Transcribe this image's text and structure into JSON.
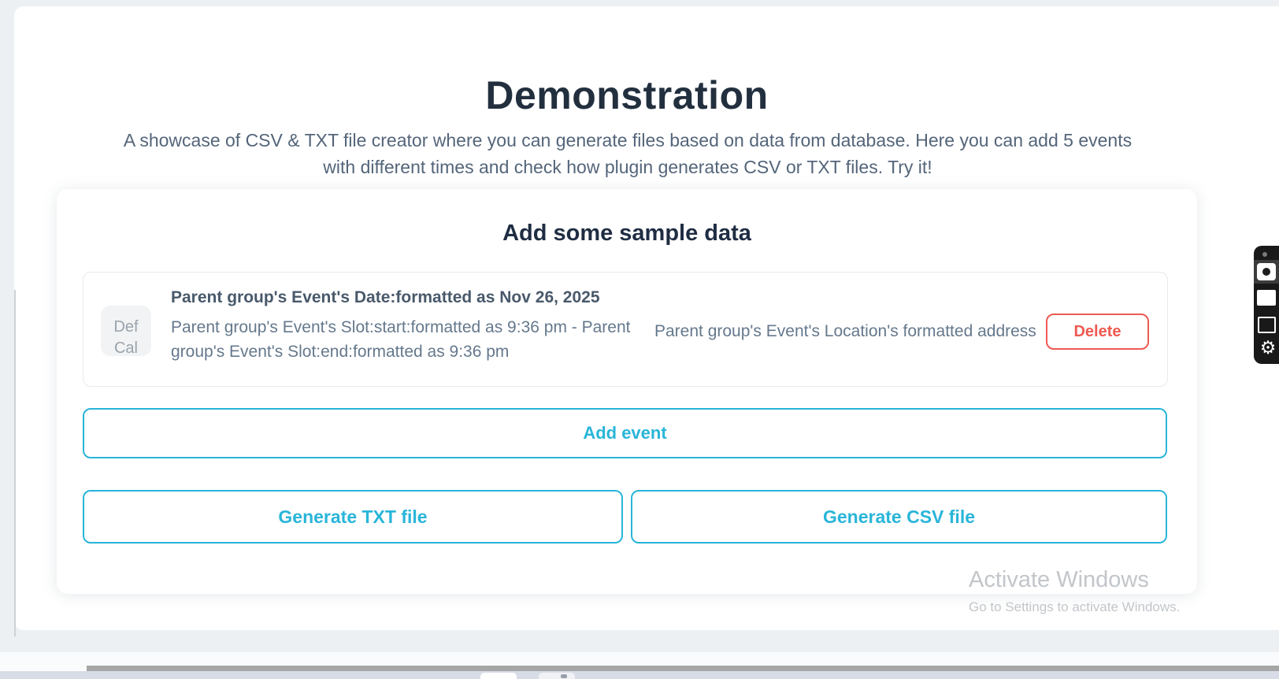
{
  "colors": {
    "accent": "#29b5d9",
    "danger": "#ee5a52",
    "heading": "#222f3e",
    "body_text": "#65788c",
    "page_background": "#ecf0f2"
  },
  "header": {
    "title": "Demonstration",
    "subtitle": "A showcase of CSV & TXT file creator where you can generate files based on data from database. Here you can add 5 events with different times and check how plugin generates CSV or TXT files. Try it!"
  },
  "card": {
    "heading": "Add some sample data",
    "event": {
      "icon_text": "Def Cal",
      "date": "Parent group's Event's Date:formatted as Nov 26, 2025",
      "time_range": "Parent group's Event's Slot:start:formatted as 9:36 pm - Parent group's Event's Slot:end:formatted as 9:36 pm",
      "location": "Parent group's Event's Location's formatted address",
      "delete_label": "Delete"
    },
    "buttons": {
      "add_event": "Add event",
      "generate_txt": "Generate TXT file",
      "generate_csv": "Generate CSV file"
    }
  },
  "watermark": {
    "line1": "Activate Windows",
    "line2": "Go to Settings to activate Windows."
  },
  "side_toolbar": {
    "icons": [
      "drag-dot",
      "camera",
      "blank-square",
      "copy",
      "gear"
    ],
    "gear_glyph": "⚙"
  }
}
